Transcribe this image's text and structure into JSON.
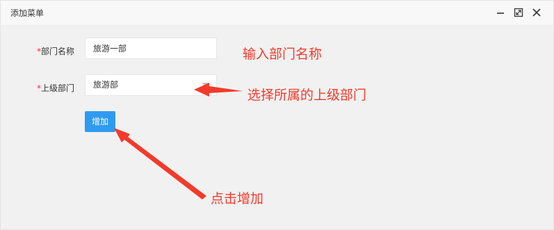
{
  "dialog": {
    "title": "添加菜单",
    "controls": {
      "minimize": "minimize-icon",
      "maximize": "maximize-icon",
      "close": "close-icon"
    }
  },
  "form": {
    "required_mark": "*",
    "dept_name": {
      "label": "部门名称",
      "value": "旅游一部"
    },
    "parent_dept": {
      "label": "上级部门",
      "value": "旅游部"
    },
    "submit_label": "增加"
  },
  "annotations": {
    "input_hint": "输入部门名称",
    "select_hint": "选择所属的上级部门",
    "click_hint": "点击增加",
    "color": "#f23b2b"
  },
  "colors": {
    "accent": "#2f9bf0",
    "annotation": "#f23b2b"
  }
}
